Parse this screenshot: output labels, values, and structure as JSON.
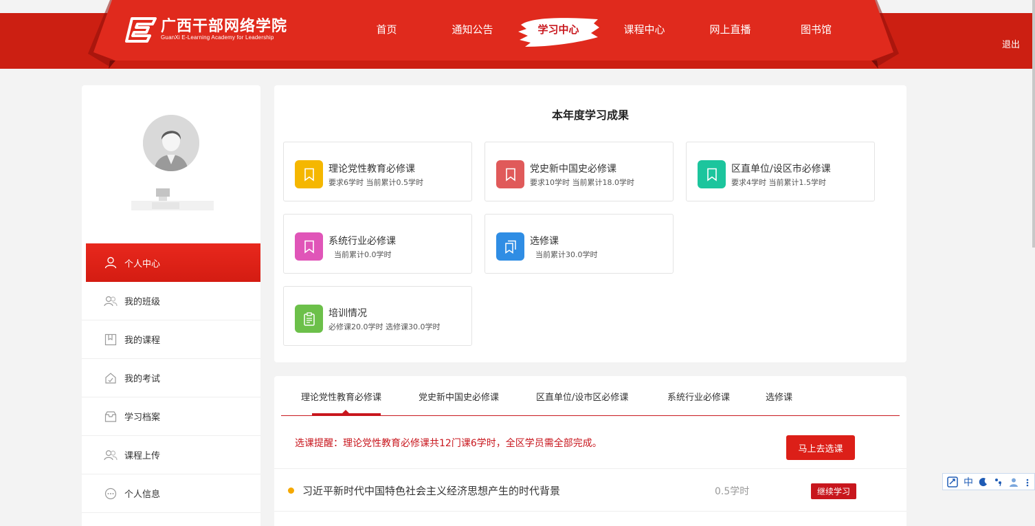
{
  "header": {
    "logo_cn": "广西干部网络学院",
    "logo_en": "GuanXi E-Learning Academy for Leadership",
    "nav": [
      "首页",
      "通知公告",
      "学习中心",
      "课程中心",
      "网上直播",
      "图书馆"
    ],
    "active_nav": "学习中心",
    "logout": "退出"
  },
  "sidebar": {
    "items": [
      {
        "label": "个人中心",
        "icon": "user-icon"
      },
      {
        "label": "我的班级",
        "icon": "group-icon"
      },
      {
        "label": "我的课程",
        "icon": "book-icon"
      },
      {
        "label": "我的考试",
        "icon": "exam-icon"
      },
      {
        "label": "学习档案",
        "icon": "archive-icon"
      },
      {
        "label": "课程上传",
        "icon": "upload-icon"
      },
      {
        "label": "个人信息",
        "icon": "chat-icon"
      }
    ]
  },
  "results": {
    "title": "本年度学习成果",
    "tiles": [
      {
        "title": "理论党性教育必修课",
        "sub": "要求6学时  当前累计0.5学时",
        "color": "#f5b700",
        "icon": "bookmark-icon"
      },
      {
        "title": "党史新中国史必修课",
        "sub": "要求10学时  当前累计18.0学时",
        "color": "#e05a5a",
        "icon": "bookmark-icon"
      },
      {
        "title": "区直单位/设区市必修课",
        "sub": "要求4学时  当前累计1.5学时",
        "color": "#1cc59d",
        "icon": "bookmark-icon"
      },
      {
        "title": "系统行业必修课",
        "sub": "当前累计0.0学时",
        "color": "#e055b8",
        "icon": "bookmark-icon"
      },
      {
        "title": "选修课",
        "sub": "当前累计30.0学时",
        "color": "#2f8de4",
        "icon": "bookmarks-icon"
      },
      {
        "title": "培训情况",
        "sub": "必修课20.0学时  选修课30.0学时",
        "color": "#6cc04a",
        "icon": "clipboard-icon"
      }
    ]
  },
  "courses_panel": {
    "tabs": [
      "理论党性教育必修课",
      "党史新中国史必修课",
      "区直单位/设市区必修课",
      "系统行业必修课",
      "选修课"
    ],
    "notice": "选课提醒：理论党性教育必修课共12门课6学时，全区学员需全部完成。",
    "go_button": "马上去选课",
    "courses": [
      {
        "title": "习近平新时代中国特色社会主义经济思想产生的时代背景",
        "hours": "0.5学时",
        "action": "继续学习"
      }
    ]
  },
  "ime": {
    "lang": "中"
  }
}
